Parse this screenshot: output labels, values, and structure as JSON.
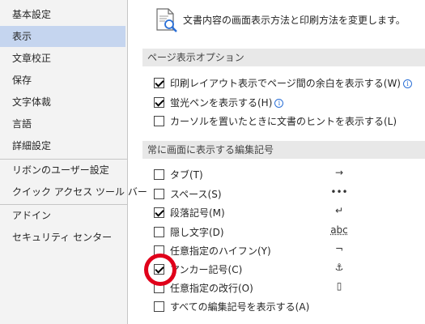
{
  "sidebar": {
    "items": [
      {
        "label": "基本設定"
      },
      {
        "label": "表示"
      },
      {
        "label": "文章校正"
      },
      {
        "label": "保存"
      },
      {
        "label": "文字体裁"
      },
      {
        "label": "言語"
      },
      {
        "label": "詳細設定"
      },
      {
        "label": "リボンのユーザー設定"
      },
      {
        "label": "クイック アクセス ツール バー"
      },
      {
        "label": "アドイン"
      },
      {
        "label": "セキュリティ センター"
      }
    ],
    "selected_index": 1
  },
  "header": {
    "description": "文書内容の画面表示方法と印刷方法を変更します。",
    "icon": "document-magnifier-icon"
  },
  "page_display": {
    "title": "ページ表示オプション",
    "options": [
      {
        "label": "印刷レイアウト表示でページ間の余白を表示する(W)",
        "checked": true,
        "info": true
      },
      {
        "label": "蛍光ペンを表示する(H)",
        "checked": true,
        "info": true
      },
      {
        "label": "カーソルを置いたときに文書のヒントを表示する(L)",
        "checked": false,
        "info": false
      }
    ]
  },
  "formatting_marks": {
    "title": "常に画面に表示する編集記号",
    "options": [
      {
        "label": "タブ(T)",
        "checked": false,
        "symbol": "→"
      },
      {
        "label": "スペース(S)",
        "checked": false,
        "symbol": "•••"
      },
      {
        "label": "段落記号(M)",
        "checked": true,
        "symbol": "↵"
      },
      {
        "label": "隠し文字(D)",
        "checked": false,
        "symbol": "abc"
      },
      {
        "label": "任意指定のハイフン(Y)",
        "checked": false,
        "symbol": "¬"
      },
      {
        "label": "アンカー記号(C)",
        "checked": true,
        "symbol": "⚓"
      },
      {
        "label": "任意指定の改行(O)",
        "checked": false,
        "symbol": "▯"
      },
      {
        "label": "すべての編集記号を表示する(A)",
        "checked": false,
        "symbol": ""
      }
    ]
  },
  "colors": {
    "selected_bg": "#c5d5ef",
    "section_bg": "#e8e8e8",
    "annotation_circle": "#e0001a"
  }
}
